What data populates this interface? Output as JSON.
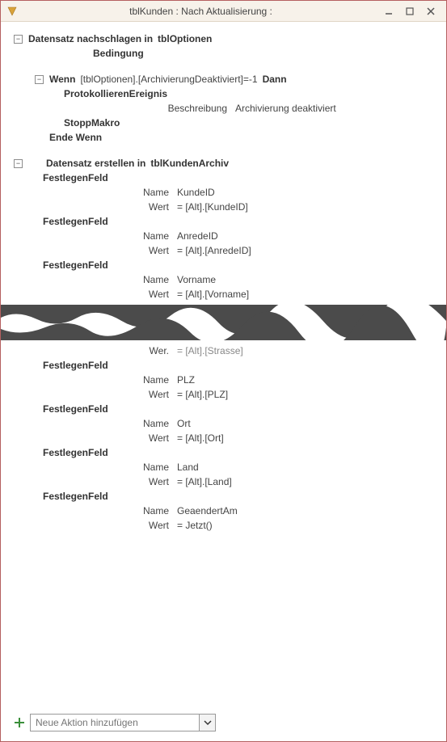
{
  "window": {
    "title": "tblKunden : Nach Aktualisierung :"
  },
  "macro": {
    "lookup": {
      "action": "Datensatz nachschlagen in",
      "target": "tblOptionen",
      "conditionLabel": "Bedingung"
    },
    "wenn": {
      "keyword": "Wenn",
      "expr": "[tblOptionen].[ArchivierungDeaktiviert]=-1",
      "then": "Dann",
      "log": {
        "action": "ProtokollierenEreignis",
        "descLabel": "Beschreibung",
        "descValue": "Archivierung deaktiviert"
      },
      "stop": "StoppMakro",
      "end": "Ende Wenn"
    },
    "create": {
      "action": "Datensatz erstellen in",
      "target": "tblKundenArchiv",
      "setField": "FestlegenFeld",
      "nameLabel": "Name",
      "valueLabel": "Wert",
      "truncValueLabel": "Wer.",
      "fieldsTop": [
        {
          "name": "KundeID",
          "value": "= [Alt].[KundeID]"
        },
        {
          "name": "AnredeID",
          "value": "= [Alt].[AnredeID]"
        },
        {
          "name": "Vorname",
          "value": "= [Alt].[Vorname]"
        }
      ],
      "torn": {
        "value": "= [Alt].[Strasse]"
      },
      "fieldsBottom": [
        {
          "name": "PLZ",
          "value": "= [Alt].[PLZ]"
        },
        {
          "name": "Ort",
          "value": "= [Alt].[Ort]"
        },
        {
          "name": "Land",
          "value": "= [Alt].[Land]"
        },
        {
          "name": "GeaendertAm",
          "value": "= Jetzt()"
        }
      ]
    }
  },
  "footer": {
    "addActionPlaceholder": "Neue Aktion hinzufügen"
  }
}
